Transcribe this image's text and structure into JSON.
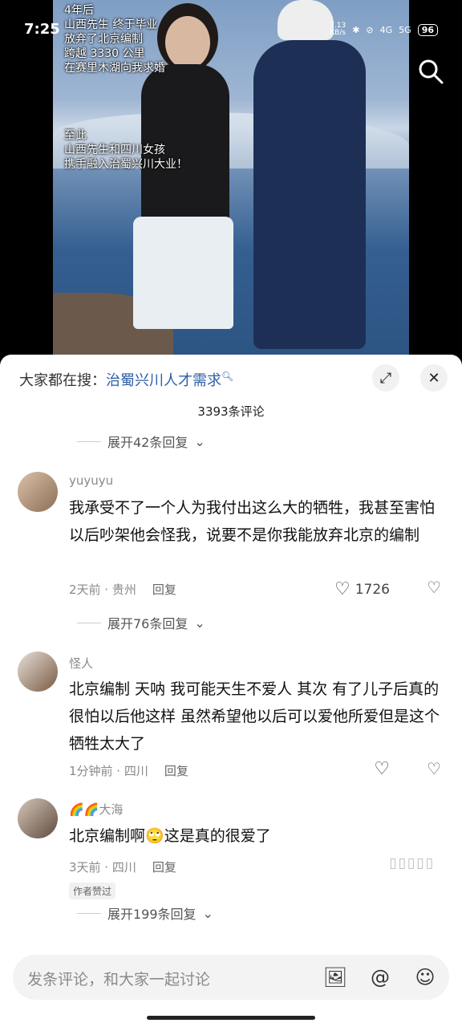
{
  "status_bar": {
    "time": "7:25",
    "net_speed": "7.13\nKB/s",
    "signal_4g": "4G",
    "signal_5g": "5G",
    "battery": "96"
  },
  "video": {
    "caption_lines_1": [
      "4年后",
      "山西先生 终于毕业",
      "放弃了北京编制",
      "跨越 3330 公里",
      "在赛里木湖向我求婚"
    ],
    "caption_lines_2": [
      "至此",
      "山西先生和四川女孩",
      "携手融入治蜀兴川大业！"
    ]
  },
  "header": {
    "search_prefix": "大家都在搜：",
    "search_query": "治蜀兴川人才需求",
    "comment_count": "3393条评论"
  },
  "top_expand": "展开42条回复",
  "comments": [
    {
      "user": "yuyuyu",
      "text": "我承受不了一个人为我付出这么大的牺牲，我甚至害怕以后吵架他会怪我，说要不是你我能放弃北京的编制",
      "time_loc": "2天前 · 贵州",
      "reply": "回复",
      "likes": "1726",
      "expand": "展开76条回复"
    },
    {
      "user": "怪人",
      "text": "北京编制 天呐 我可能天生不爱人 其次 有了儿子后真的很怕以后他这样 虽然希望他以后可以爱他所爱但是这个牺牲太大了",
      "time_loc": "1分钟前 · 四川",
      "reply": "回复"
    },
    {
      "user": "🌈🌈大海",
      "text_a": "北京编制啊",
      "emoji": "🙄",
      "text_b": "这是真的很爱了",
      "time_loc": "3天前 · 四川",
      "reply": "回复",
      "badge": "作者赞过",
      "expand": "展开199条回复"
    }
  ],
  "input": {
    "placeholder": "发条评论，和大家一起讨论"
  }
}
